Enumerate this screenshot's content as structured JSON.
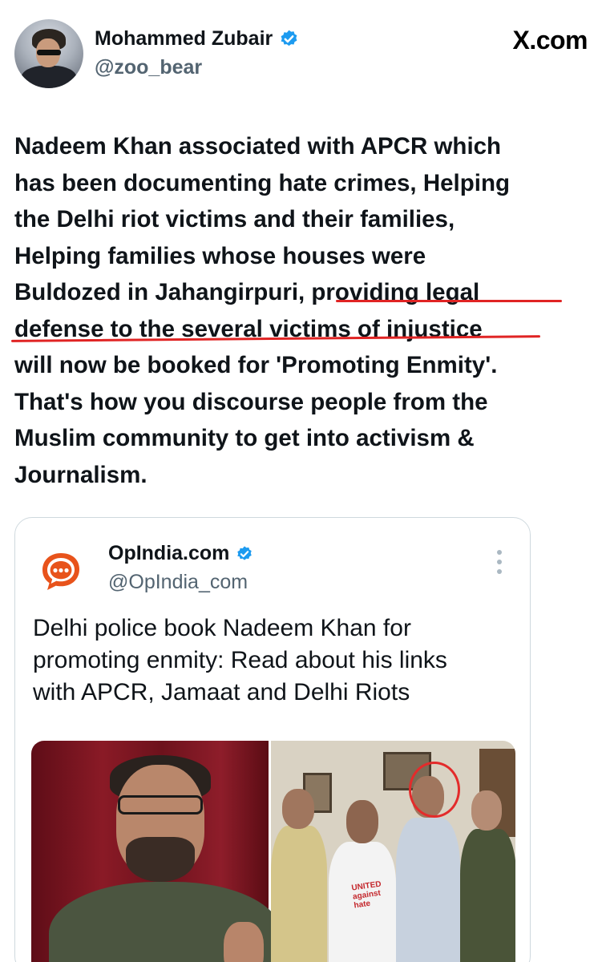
{
  "author": {
    "display_name": "Mohammed Zubair",
    "handle": "@zoo_bear",
    "verified": true
  },
  "site_label": "X.com",
  "tweet": {
    "lines": [
      "Nadeem Khan associated with APCR which",
      "has been documenting hate crimes, Helping",
      "the Delhi riot victims and their families,",
      "Helping families whose houses were",
      "Buldozed in Jahangirpuri, providing legal",
      "defense to the several victims of injustice",
      "will now be booked for 'Promoting Enmity'.",
      "That's how you discourse people from the",
      "Muslim community to get into activism &",
      "Journalism."
    ]
  },
  "quoted_tweet": {
    "display_name": "OpIndia.com",
    "handle": "@OpIndia_com",
    "verified": true,
    "text_lines": [
      "Delhi police book Nadeem Khan for",
      "promoting enmity: Read about his links",
      "with APCR, Jamaat and Delhi Riots"
    ],
    "shirt_text": [
      "UNITED",
      "against",
      "hate"
    ]
  },
  "colors": {
    "verified_blue": "#1d9bf0",
    "underline_red": "#e02424",
    "opindia_orange": "#e8531b",
    "muted_text": "#536471"
  },
  "icons": [
    "verified-badge-icon",
    "opindia-logo-icon",
    "more-options-icon"
  ]
}
